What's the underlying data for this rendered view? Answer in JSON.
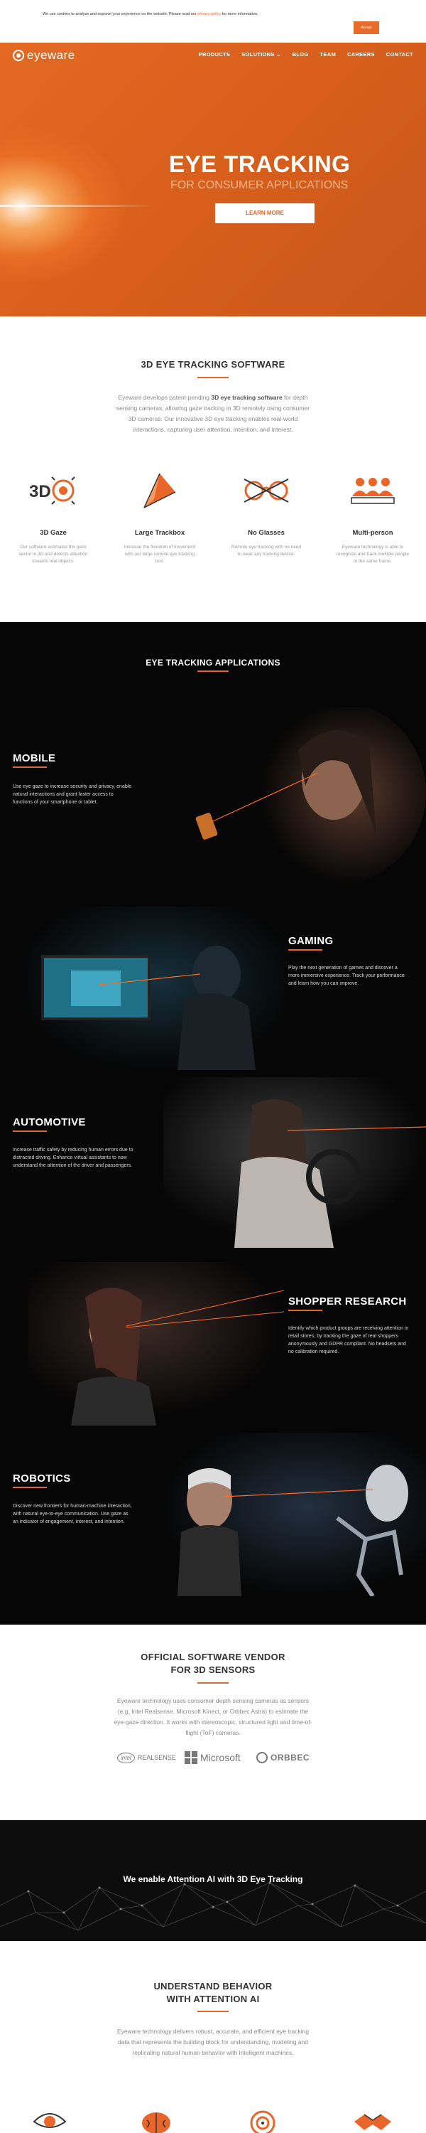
{
  "cookie": {
    "text_before": "We use cookies to analyze and improve your experience on the website. Please read our",
    "link": "privacy policy",
    "text_after": "for more information.",
    "accept": "Accept"
  },
  "nav": {
    "logo": "eyeware",
    "items": [
      "PRODUCTS",
      "SOLUTIONS ⌄",
      "BLOG",
      "TEAM",
      "CAREERS",
      "CONTACT"
    ]
  },
  "hero": {
    "title": "EYE TRACKING",
    "subtitle": "FOR CONSUMER APPLICATIONS",
    "button": "LEARN MORE"
  },
  "software": {
    "title": "3D EYE TRACKING SOFTWARE",
    "body_1": "Eyeware develops patent-pending",
    "body_bold": "3D eye tracking software",
    "body_2": "for depth sensing cameras, allowing gaze tracking in 3D remotely using consumer 3D cameras. Our innovative 3D eye tracking enables real-world interactions, capturing user attention, intention, and interest."
  },
  "features": [
    {
      "icon": "3d-gaze-icon",
      "title": "3D Gaze",
      "desc": "Our software estimates the gaze vector in 3D and detects attention towards real objects."
    },
    {
      "icon": "trackbox-icon",
      "title": "Large Trackbox",
      "desc": "Increase the freedom of movement with our large remote eye tracking box."
    },
    {
      "icon": "glasses-icon",
      "title": "No Glasses",
      "desc": "Remote eye tracking with no need to wear any tracking device."
    },
    {
      "icon": "multi-person-icon",
      "title": "Multi-person",
      "desc": "Eyeware technology is able to recognize and track multiple people in the same frame."
    }
  ],
  "applications": {
    "title": "EYE TRACKING APPLICATIONS",
    "items": [
      {
        "title": "MOBILE",
        "desc": "Use eye gaze to increase security and privacy, enable natural interactions and grant faster access to functions of your smartphone or tablet."
      },
      {
        "title": "GAMING",
        "desc": "Play the next generation of games and discover a more immersive experience. Track your performance and learn how you can improve."
      },
      {
        "title": "AUTOMOTIVE",
        "desc": "Increase traffic safety by reducing human errors due to distracted driving. Enhance virtual assistants to now understand the attention of the driver and passengers."
      },
      {
        "title": "SHOPPER RESEARCH",
        "desc": "Identify which product groups are receiving attention in retail stores, by tracking the gaze of real shoppers anonymously and GDPR compliant. No headsets and no calibration required."
      },
      {
        "title": "ROBOTICS",
        "desc": "Discover new frontiers for human-machine interaction, with natural eye-to-eye communication. Use gaze as an indicator of engagement, interest, and intention."
      }
    ]
  },
  "vendor": {
    "title_1": "OFFICIAL SOFTWARE VENDOR",
    "title_2": "FOR 3D SENSORS",
    "body": "Eyeware technology uses consumer depth sensing cameras as sensors (e.g. Intel Realsense, Microsoft Kinect, or Orbbec Astra) to estimate the eye-gaze direction. It works with stereoscopic, structured light and time-of-flight (ToF) cameras.",
    "logos": {
      "intel": "intel",
      "realsense": "REALSENSE",
      "microsoft": "Microsoft",
      "orbbec": "ORBBEC"
    }
  },
  "network": {
    "text": "We enable Attention AI with 3D Eye Tracking"
  },
  "understand": {
    "title_1": "UNDERSTAND BEHAVIOR",
    "title_2": "WITH ATTENTION AI",
    "body": "Eyeware technology delivers robust, accurate, and efficient eye tracking data that represents the building block for understanding, modeling and replicating natural human behavior with intelligent machines."
  },
  "colors": {
    "brand": "#e8662a",
    "dark": "#060606"
  }
}
